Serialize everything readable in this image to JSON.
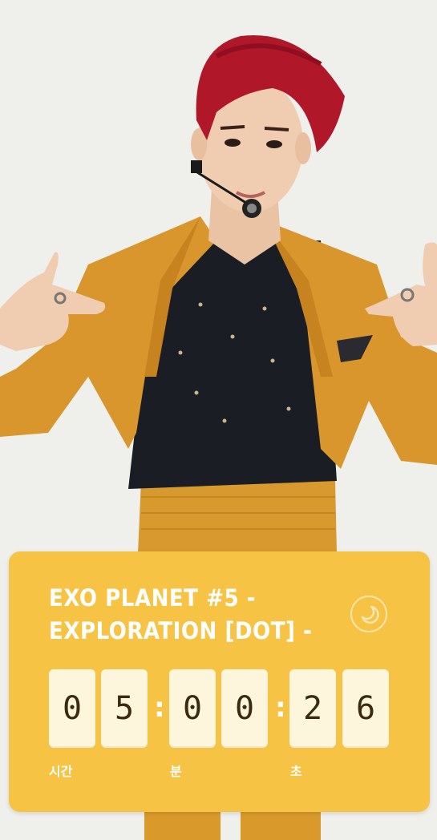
{
  "story": {
    "background": "performer photo",
    "accent_color": "#f6c344"
  },
  "countdown": {
    "title_line1": "EXO PLANET #5 -",
    "title_line2": "EXPLORATION [DOT] -",
    "action_icon": "moon-circle-icon",
    "digits": {
      "hours_tens": "0",
      "hours_ones": "5",
      "minutes_tens": "0",
      "minutes_ones": "0",
      "seconds_tens": "2",
      "seconds_ones": "6"
    },
    "separator": ":",
    "labels": {
      "hours": "시간",
      "minutes": "분",
      "seconds": "초"
    }
  }
}
